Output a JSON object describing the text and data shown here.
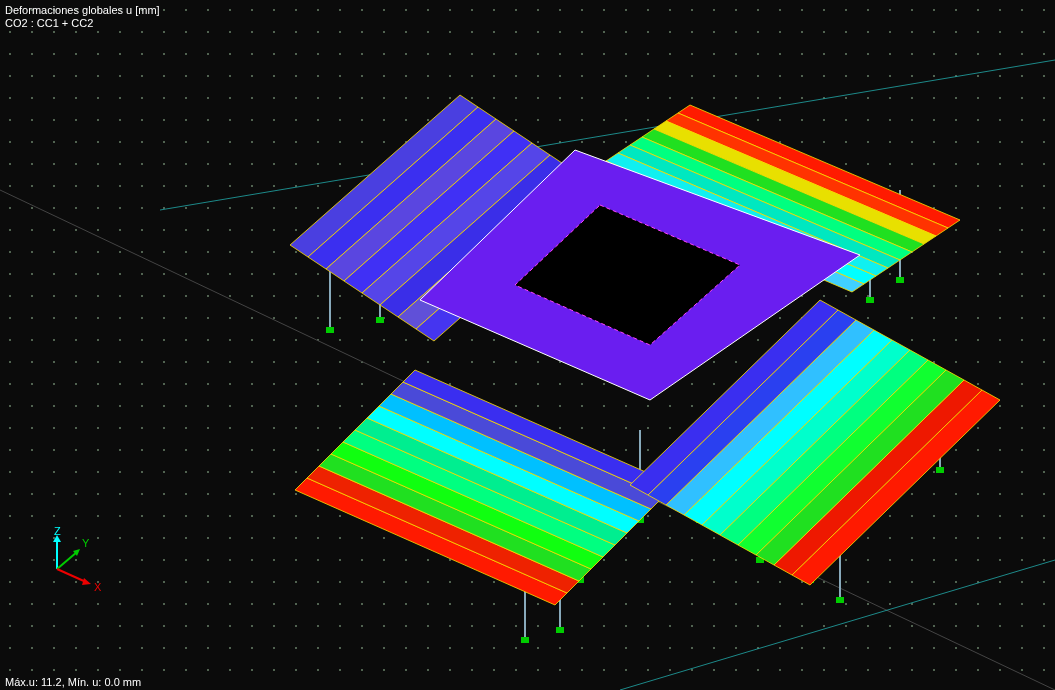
{
  "viewport": {
    "title": "Deformaciones globales u [mm]",
    "combination": "CO2 : CC1 + CC2",
    "status": "Máx.u: 11.2, Mín. u: 0.0 mm"
  },
  "axes": {
    "x": "X",
    "y": "Y",
    "z": "Z"
  }
}
